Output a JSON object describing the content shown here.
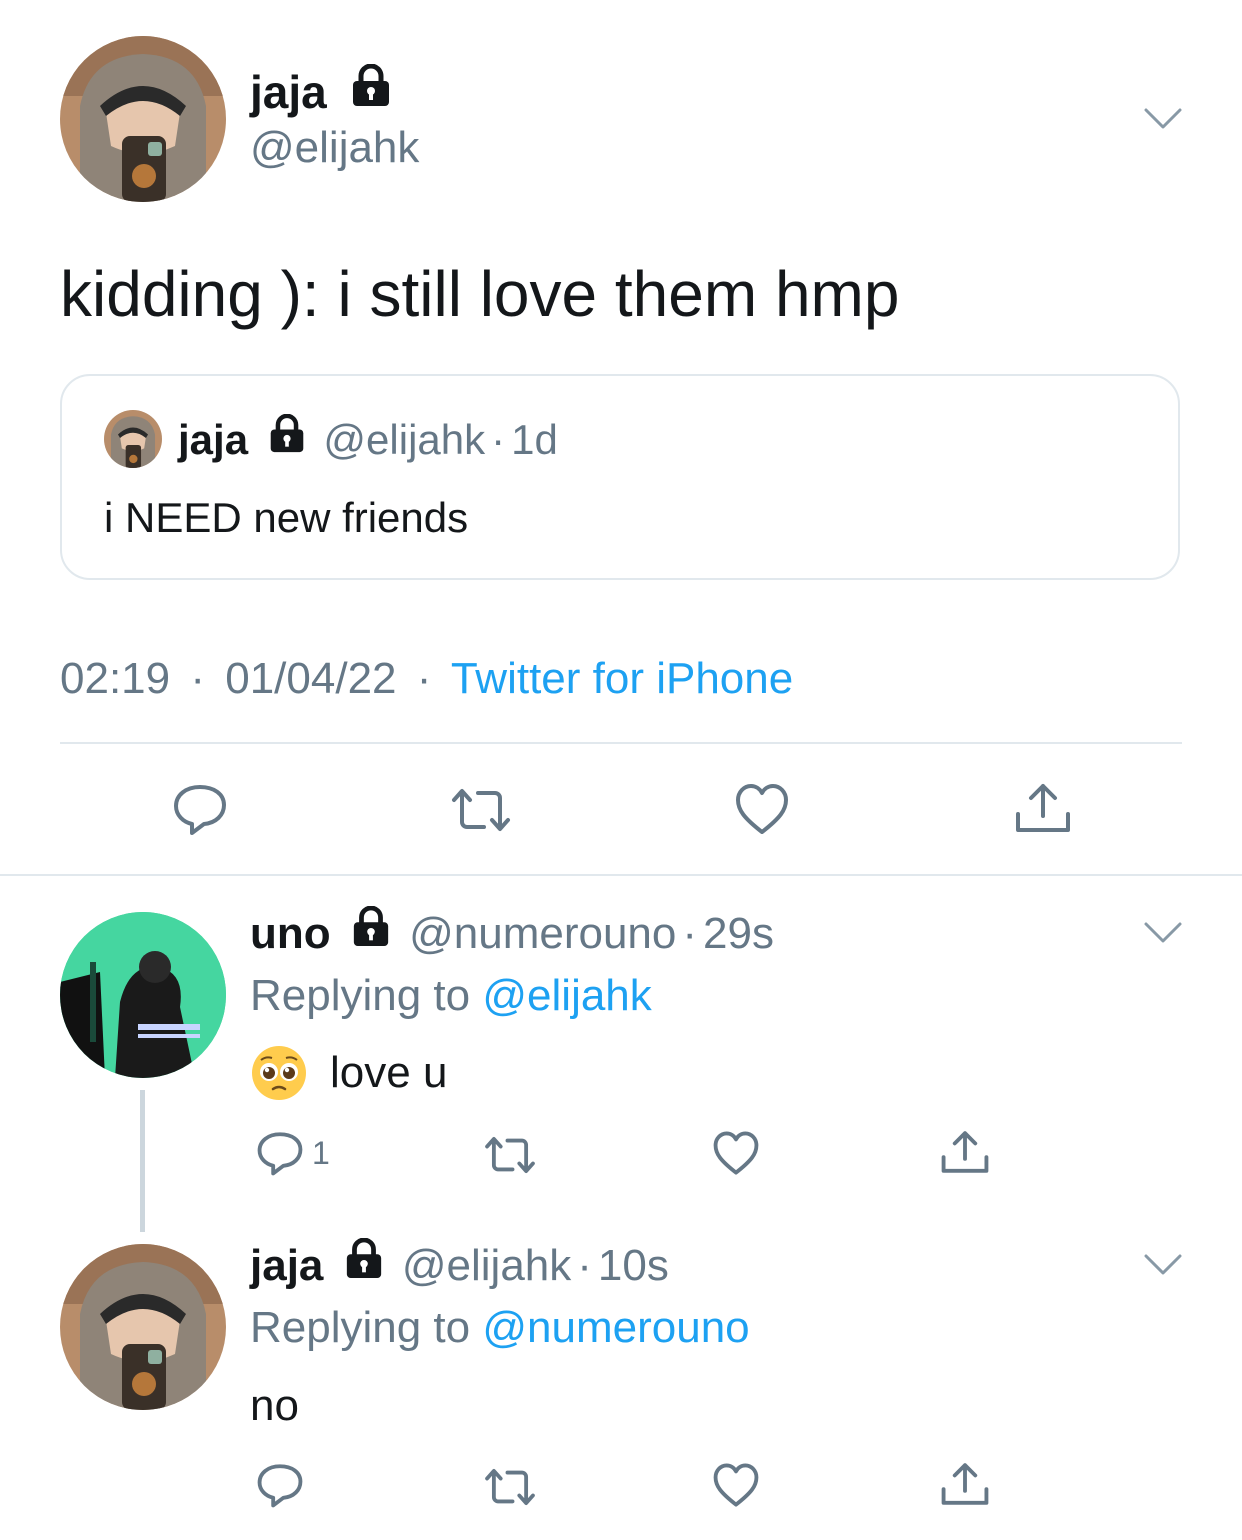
{
  "main_tweet": {
    "display_name": "jaja",
    "handle": "@elijahk",
    "text": "kidding ): i still love them hmp",
    "quoted": {
      "display_name": "jaja",
      "handle": "@elijahk",
      "separator": "·",
      "time": "1d",
      "text": "i NEED new friends"
    },
    "meta": {
      "time": "02:19",
      "separator1": "·",
      "date": "01/04/22",
      "separator2": "·",
      "source": "Twitter for iPhone"
    }
  },
  "replies": [
    {
      "display_name": "uno",
      "handle": "@numerouno",
      "separator": "·",
      "time": "29s",
      "replying_prefix": "Replying to",
      "replying_to": "@elijahk",
      "emoji": "🥺",
      "text": "love u",
      "reply_count": "1"
    },
    {
      "display_name": "jaja",
      "handle": "@elijahk",
      "separator": "·",
      "time": "10s",
      "replying_prefix": "Replying to",
      "replying_to": "@numerouno",
      "text": "no",
      "reply_count": ""
    }
  ],
  "icons": {
    "lock": "lock-icon",
    "chevron": "chevron-down-icon",
    "reply": "reply-icon",
    "retweet": "retweet-icon",
    "like": "heart-icon",
    "share": "share-icon"
  },
  "colors": {
    "accent": "#1da1f2",
    "secondary_text": "#657786",
    "divider": "#e1e8ed",
    "thread_line": "#ccd6dd"
  }
}
